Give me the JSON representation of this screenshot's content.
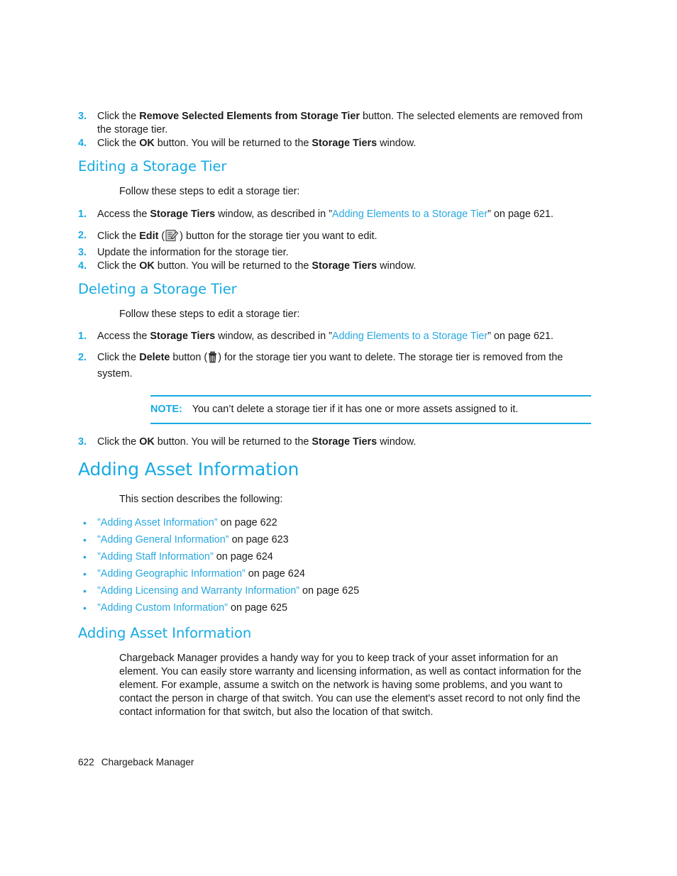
{
  "document": {
    "footer": {
      "page_number": "622",
      "chapter_title": "Chargeback Manager"
    },
    "colors": {
      "heading_blue": "#17aae2",
      "link_blue": "#29a8e0",
      "body_text": "#1a1a1a"
    }
  },
  "top_steps": {
    "items": [
      {
        "number": "3.",
        "lead": "Click the ",
        "bold": "Remove Selected Elements from Storage Tier",
        "tail": " button. The selected elements are removed from the storage tier."
      },
      {
        "number": "4.",
        "lead": "Click the ",
        "bold": "OK",
        "mid": " button. You will be returned to the ",
        "bold2": "Storage Tiers",
        "tail": " window."
      }
    ]
  },
  "editing_section": {
    "heading": "Editing a Storage Tier",
    "intro": "Follow these steps to edit a storage tier:",
    "steps": [
      {
        "number": "1.",
        "lead": "Access the ",
        "bold": "Storage Tiers",
        "mid": " window, as described in ”",
        "link": "Adding Elements to a Storage Tier",
        "tail": "” on page 621."
      },
      {
        "number": "2.",
        "lead": "Click the ",
        "bold": "Edit",
        "mid": " (",
        "icon": "edit-pencil-icon",
        "tail": ") button for the storage tier you want to edit."
      },
      {
        "number": "3.",
        "lead": "Update the information for the storage tier."
      },
      {
        "number": "4.",
        "lead": "Click the ",
        "bold": "OK",
        "mid": " button. You will be returned to the ",
        "bold2": "Storage Tiers",
        "tail": " window."
      }
    ]
  },
  "deleting_section": {
    "heading": "Deleting a Storage Tier",
    "intro": "Follow these steps to edit a storage tier:",
    "steps": [
      {
        "number": "1.",
        "lead": "Access the ",
        "bold": "Storage Tiers",
        "mid": " window, as described in ”",
        "link": "Adding Elements to a Storage Tier",
        "tail": "” on page 621."
      },
      {
        "number": "2.",
        "lead": "Click the ",
        "bold": "Delete",
        "mid": " button (",
        "icon": "trash-can-icon",
        "tail": ") for the storage tier you want to delete. The storage tier is removed from the system."
      }
    ],
    "note": {
      "label": "NOTE:",
      "text": "You can’t delete a storage tier if it has one or more assets assigned to it."
    },
    "final_step": {
      "number": "3.",
      "lead": "Click the ",
      "bold": "OK",
      "mid": " button. You will be returned to the ",
      "bold2": "Storage Tiers",
      "tail": " window."
    }
  },
  "adding_asset_information_chapter": {
    "heading": "Adding Asset Information",
    "intro": "This section describes the following:",
    "links": [
      {
        "open_quote": "”",
        "title": "Adding Asset Information",
        "close_quote": "”",
        "page_ref": " on page 622"
      },
      {
        "open_quote": "”",
        "title": "Adding General Information",
        "close_quote": "”",
        "page_ref": " on page 623"
      },
      {
        "open_quote": "”",
        "title": "Adding Staff Information",
        "close_quote": "”",
        "page_ref": " on page 624"
      },
      {
        "open_quote": "”",
        "title": "Adding Geographic Information",
        "close_quote": "”",
        "page_ref": " on page 624"
      },
      {
        "open_quote": "”",
        "title": "Adding Licensing and Warranty Information",
        "close_quote": "”",
        "page_ref": " on page 625"
      },
      {
        "open_quote": "”",
        "title": "Adding Custom Information",
        "close_quote": "”",
        "page_ref": " on page 625"
      }
    ]
  },
  "adding_asset_information_section": {
    "heading": "Adding Asset Information",
    "paragraph": "Chargeback Manager provides a handy way for you to keep track of your asset information for an element. You can easily store warranty and licensing information, as well as contact information for the element. For example, assume a switch on the network is having some problems, and you want to contact the person in charge of that switch. You can use the element's asset record to not only find the contact information for that switch, but also the location of that switch."
  }
}
